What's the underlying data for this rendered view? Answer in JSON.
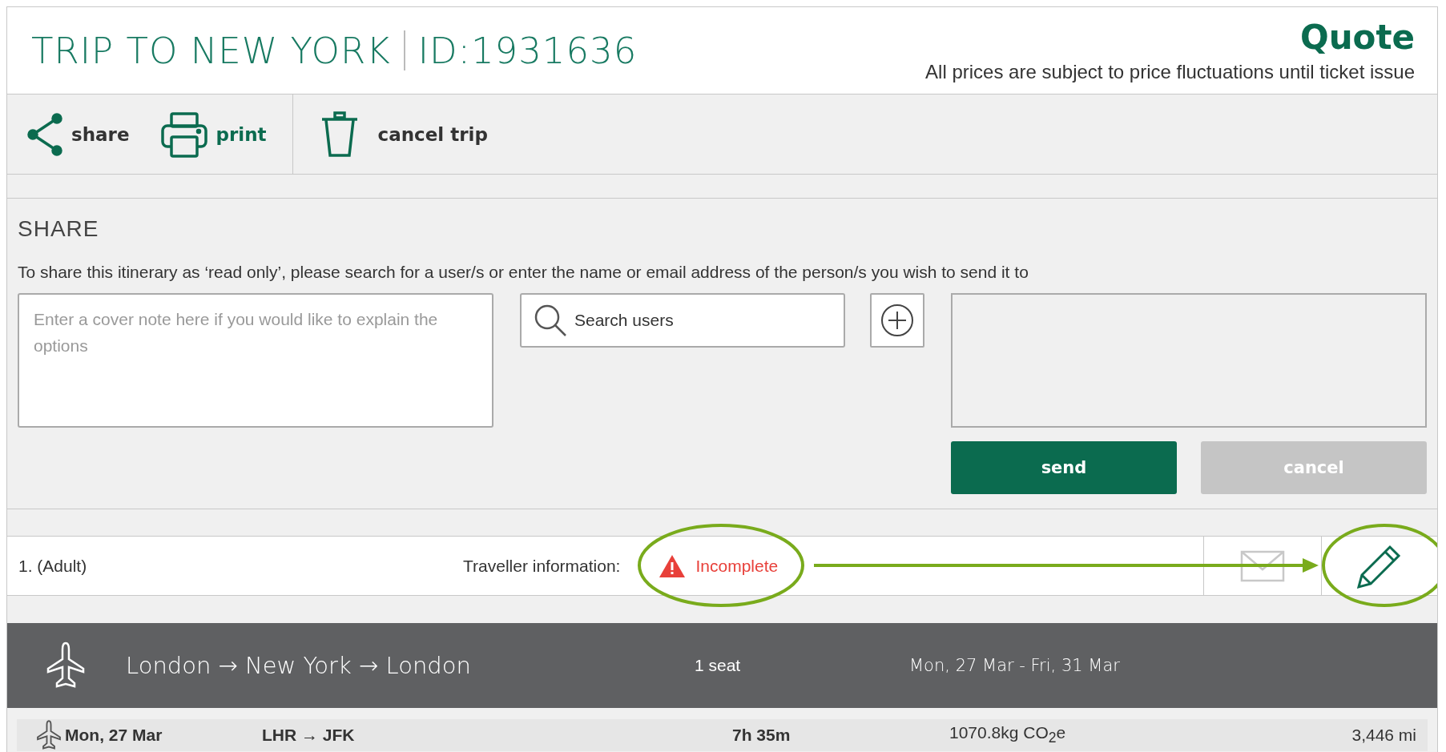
{
  "header": {
    "title": "TRIP TO NEW YORK",
    "trip_id": "ID:1931636",
    "status": "Quote",
    "note": "All prices are subject to price fluctuations until ticket issue"
  },
  "toolbar": [
    {
      "kind": "share",
      "label": "share"
    },
    {
      "kind": "print",
      "label": "print"
    },
    {
      "kind": "trash",
      "label": "cancel trip"
    }
  ],
  "share": {
    "heading": "SHARE",
    "instructions": "To share this itinerary as ‘read only’, please search for a user/s or enter the name or email address of the person/s you wish to send it to",
    "cover_note": {
      "placeholder": "Enter a cover note here if you would like to explain the options"
    },
    "search": {
      "placeholder": "Search users"
    },
    "buttons": [
      {
        "label": "send",
        "disabled": false
      },
      {
        "label": "cancel",
        "disabled": true
      }
    ]
  },
  "traveller": {
    "name": "1. (Adult)",
    "label": "Traveller information:",
    "status": "Incomplete",
    "status_highlighted": true,
    "edit_highlighted": true
  },
  "trip": {
    "route": "London → New York → London",
    "seats": "1 seat",
    "dates": "Mon, 27 Mar - Fri, 31 Mar"
  },
  "flight": {
    "date": "Mon, 27 Mar",
    "route": "LHR → JFK",
    "duration": "7h 35m",
    "emissions": "1070.8kg CO$_{2}$e",
    "distance": "3,446 mi"
  }
}
